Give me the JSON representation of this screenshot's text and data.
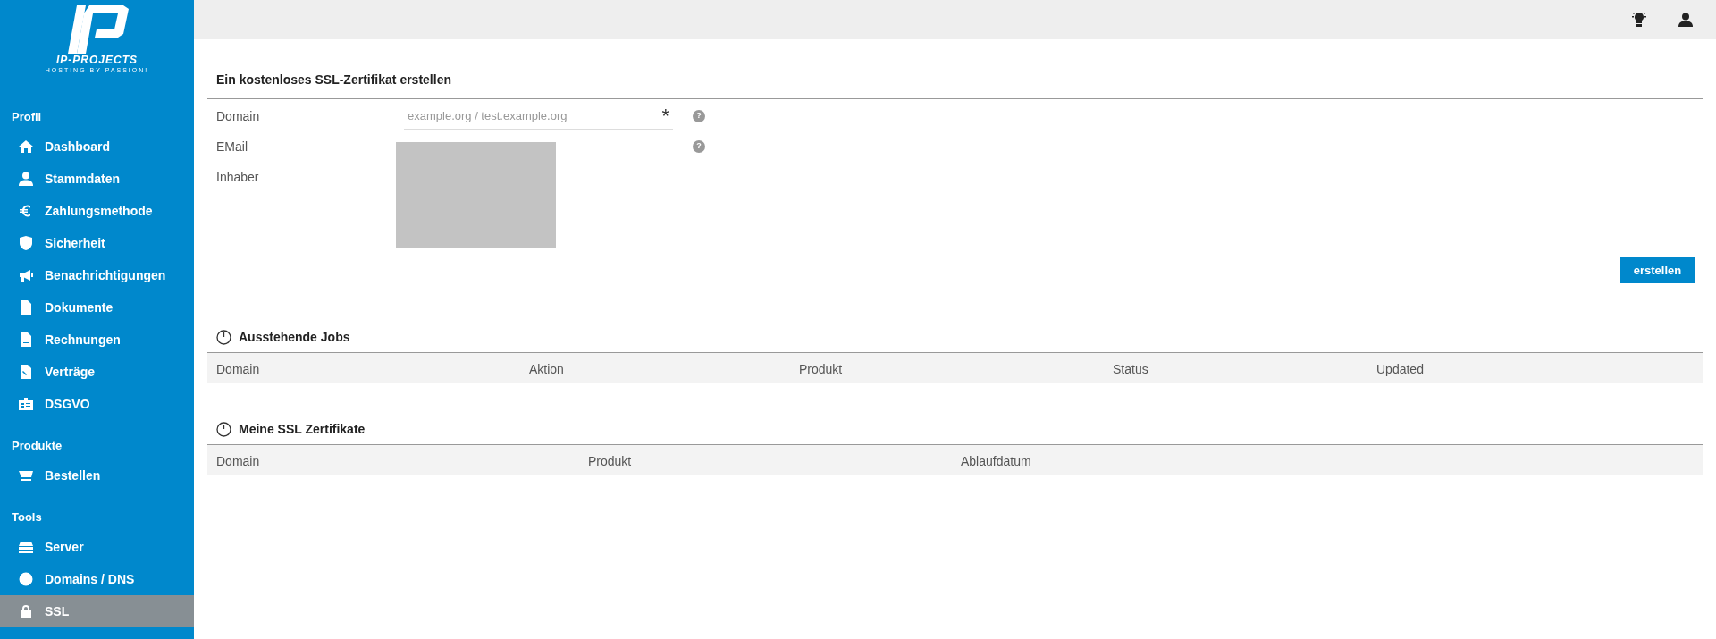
{
  "logo": {
    "name": "IP-PROJECTS",
    "tagline": "HOSTING BY PASSION!"
  },
  "sidebar": {
    "sections": [
      {
        "title": "Profil",
        "items": [
          {
            "label": "Dashboard",
            "selected": false
          },
          {
            "label": "Stammdaten",
            "selected": false
          },
          {
            "label": "Zahlungsmethode",
            "selected": false
          },
          {
            "label": "Sicherheit",
            "selected": false
          },
          {
            "label": "Benachrichtigungen",
            "selected": false
          },
          {
            "label": "Dokumente",
            "selected": false
          },
          {
            "label": "Rechnungen",
            "selected": false
          },
          {
            "label": "Verträge",
            "selected": false
          },
          {
            "label": "DSGVO",
            "selected": false
          }
        ]
      },
      {
        "title": "Produkte",
        "items": [
          {
            "label": "Bestellen",
            "selected": false
          }
        ]
      },
      {
        "title": "Tools",
        "items": [
          {
            "label": "Server",
            "selected": false
          },
          {
            "label": "Domains / DNS",
            "selected": false
          },
          {
            "label": "SSL",
            "selected": true
          }
        ]
      }
    ]
  },
  "form": {
    "title": "Ein kostenloses SSL-Zertifikat erstellen",
    "fields": [
      {
        "label": "Domain",
        "kind": "input",
        "placeholder": "example.org / test.example.org",
        "required_mark": "*",
        "help": "?"
      },
      {
        "label": "EMail",
        "kind": "blocked",
        "help": "?"
      },
      {
        "label": "Inhaber",
        "kind": "blocked"
      }
    ],
    "submit": "erstellen"
  },
  "tables": [
    {
      "title": "Ausstehende Jobs",
      "columns": [
        "Domain",
        "Aktion",
        "Produkt",
        "Status",
        "Updated"
      ]
    },
    {
      "title": "Meine SSL Zertifikate",
      "columns": [
        "Domain",
        "Produkt",
        "Ablaufdatum"
      ]
    }
  ]
}
